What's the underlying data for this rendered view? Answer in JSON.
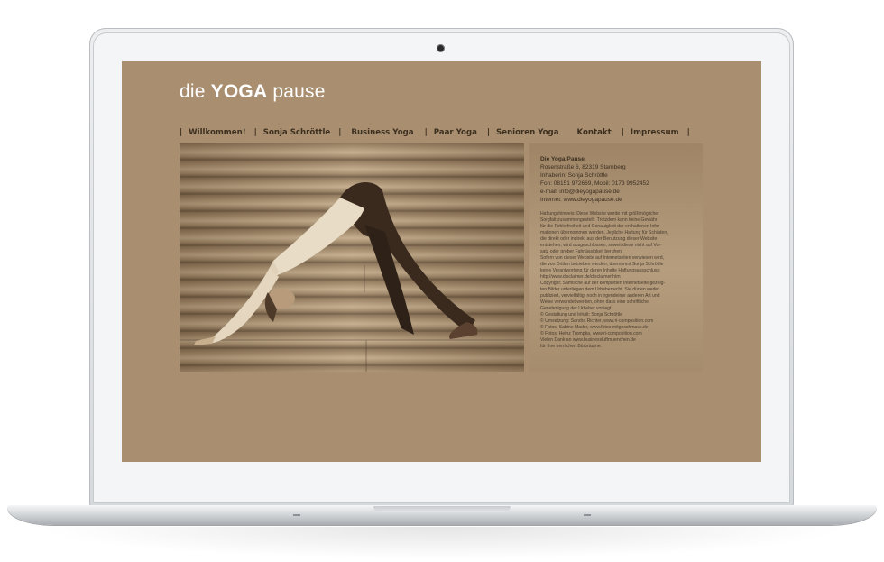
{
  "site": {
    "logo": {
      "prefix": "die",
      "brand": "YOGA",
      "suffix": "pause"
    },
    "nav": [
      {
        "label": "Willkommen!"
      },
      {
        "label": "Sonja Schröttle"
      },
      {
        "label": "Business Yoga"
      },
      {
        "label": "Paar Yoga"
      },
      {
        "label": "Senioren Yoga"
      },
      {
        "label": "Kontakt"
      },
      {
        "label": "Impressum"
      }
    ],
    "nav_separator": "|",
    "contact": {
      "title": "Die Yoga Pause",
      "lines": [
        "Rosenstraße 6, 82319 Starnberg",
        "Inhaberin: Sonja Schröttle",
        "Fon: 08151 972669, Mobil: 0173 9952452",
        "e-mail: info@dieyogapause.de",
        "Internet: www.dieyogapause.de"
      ]
    },
    "disclaimer_lines": [
      "Haftungshinweis: Diese Website wurde mit größtmöglicher",
      "Sorgfalt zusammengestellt. Trotzdem kann keine Gewähr",
      "für die Fehlerfreiheit und Genauigkeit der enthaltenen Infor-",
      "mationen übernommen werden. Jegliche Haftung für Schäden,",
      "die direkt oder indirekt aus der Benutzung dieser Website",
      "entstehen, wird ausgeschlossen, soweit diese nicht auf Vor-",
      "satz oder grober Fahrlässigkeit beruhen.",
      "Sofern von dieser Website auf Internetseiten verwiesen wird,",
      "die von Dritten betrieben werden, übernimmt Sonja Schröttle",
      "keine Verantwortung für deren Inhalte Haftungsausschluss:",
      "http://www.disclaimer.de/disclaimer.htm",
      "Copyright: Sämtliche auf der kompletten Internetseite gezeig-",
      "ten Bilder unterliegen dem Urheberrecht. Sie dürfen weder",
      "publiziert, vervielfältigt noch in irgendeiner anderen Art und",
      "Weise verwendet werden, ohne dass eine schriftliche",
      "Genehmigung der Urheber vorliegt.",
      "© Gestaltung und Inhalt: Sonja Schröttle",
      "© Umsetzung: Sandra Richter, www.ri-composition.com",
      "© Fotos: Sabine Mader, www.fotos-mitgeschmack.de",
      "© Fotos: Heinz Trompka, www.ri-composition.com",
      "Vielen Dank an www.businessluftmuenchen.de",
      "für Ihre herrlichen Büroräume."
    ],
    "colors": {
      "page_background": "#a98f6f",
      "logo_text": "#ffffff",
      "nav_text": "#3d2f20"
    }
  }
}
